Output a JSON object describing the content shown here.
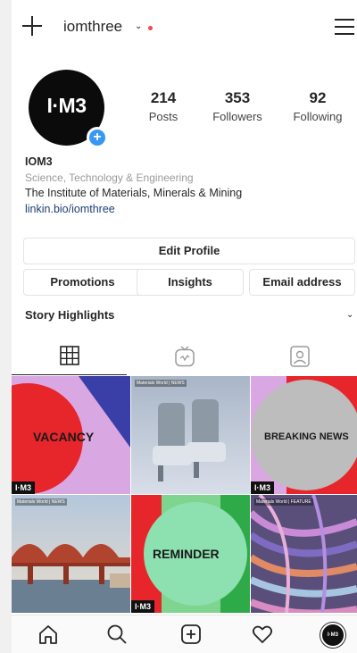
{
  "header": {
    "username": "iomthree",
    "chevron": "⌄",
    "icons": {
      "new": "plus-icon",
      "menu": "hamburger-menu-icon"
    }
  },
  "profile": {
    "avatar_text": "I·M3",
    "add_badge": "+",
    "stats": [
      {
        "value": "214",
        "label": "Posts"
      },
      {
        "value": "353",
        "label": "Followers"
      },
      {
        "value": "92",
        "label": "Following"
      }
    ],
    "name": "IOM3",
    "category": "Science, Technology & Engineering",
    "description": "The Institute of Materials, Minerals & Mining",
    "link": "linkin.bio/iomthree"
  },
  "buttons": {
    "edit_profile": "Edit Profile",
    "promotions": "Promotions",
    "insights": "Insights",
    "email": "Email address"
  },
  "highlights": {
    "label": "Story Highlights",
    "chevron": "⌄"
  },
  "tabs": [
    {
      "name": "grid-icon",
      "active": true
    },
    {
      "name": "igtv-icon",
      "active": false
    },
    {
      "name": "tagged-icon",
      "active": false
    }
  ],
  "posts": [
    {
      "text": "VACANCY",
      "logo": "I·M3"
    },
    {
      "tag": "Materials World | NEWS"
    },
    {
      "text": "BREAKING NEWS",
      "logo": "I·M3"
    },
    {
      "tag": "Materials World | NEWS"
    },
    {
      "text": "REMINDER",
      "logo": "I·M3"
    },
    {
      "tag": "Materials World | FEATURE"
    }
  ],
  "bottom_nav": {
    "items": [
      "home-icon",
      "search-icon",
      "new-post-icon",
      "activity-heart-icon",
      "profile-avatar"
    ],
    "avatar_text": "I·M3"
  },
  "colors": {
    "accent": "#3897f0",
    "notification": "#ed4956",
    "link": "#1f3f73"
  }
}
